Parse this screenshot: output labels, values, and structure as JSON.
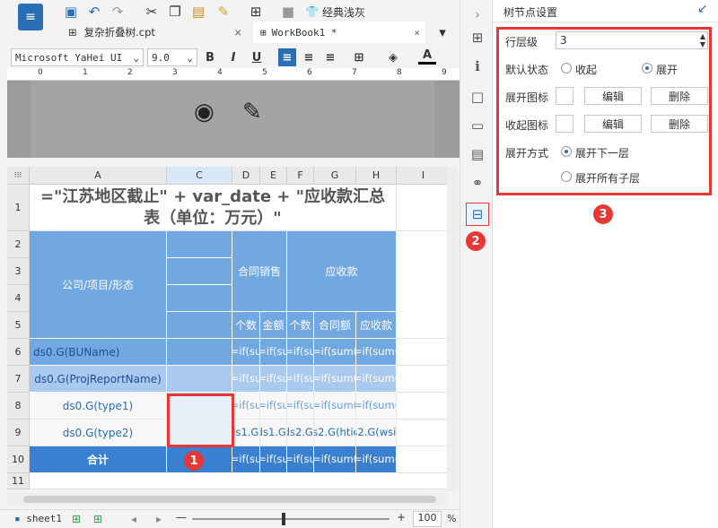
{
  "toolbar": {
    "theme_label": "经典浅灰"
  },
  "tabs": [
    {
      "label": "复杂折叠树.cpt"
    },
    {
      "label": "WorkBook1 *"
    }
  ],
  "format": {
    "font_name": "Microsoft YaHei UI",
    "font_size": "9.0",
    "bold": "B",
    "italic": "I",
    "underline": "U",
    "font_color": "A"
  },
  "ruler": {
    "ticks": [
      "0",
      "1",
      "2",
      "3",
      "4",
      "5",
      "6",
      "7",
      "8",
      "9"
    ]
  },
  "columns": [
    "A",
    "C",
    "D",
    "E",
    "F",
    "G",
    "H",
    "I"
  ],
  "rows": [
    "1",
    "2",
    "3",
    "4",
    "5",
    "6",
    "7",
    "8",
    "9",
    "10",
    "11"
  ],
  "cells": {
    "title": "=\"江苏地区截止\" + var_date + \"应收款汇总表（单位：万元）\"",
    "company": "公司/项目/形态",
    "contract_sales": "合同销售",
    "receivable": "应收款",
    "count": "个数",
    "amount": "金额",
    "count2": "个数",
    "contract_amount": "合同额",
    "receivable_amount": "应收款",
    "bu": "ds0.G(BUName)",
    "proj": "ds0.G(ProjReportName)",
    "type1": "ds0.G(type1)",
    "type2": "ds0.G(type2)",
    "total": "合计",
    "f_ifsu": "=if(su",
    "f_ifsum": "=if(sum(",
    "f_ds1g": "ds1.G(",
    "f_ds2g": "ds2.G(",
    "f_ds2htie": "ds2.G(htie)",
    "f_ds2wsie": "ds2.G(wsie)"
  },
  "status": {
    "sheet": "sheet1",
    "zoom": "100",
    "percent": "%"
  },
  "panel": {
    "title": "树节点设置",
    "level_label": "行层级",
    "level_value": "3",
    "default_state_label": "默认状态",
    "collapse": "收起",
    "expand": "展开",
    "expand_icon_label": "展开图标",
    "collapse_icon_label": "收起图标",
    "edit": "编辑",
    "delete": "删除",
    "expand_mode_label": "展开方式",
    "expand_next": "展开下一层",
    "expand_all": "展开所有子层"
  },
  "badges": {
    "b1": "1",
    "b2": "2",
    "b3": "3"
  },
  "colors": {
    "accent": "#2a6fb5",
    "annotation": "#e53935",
    "cell_blue": "#72a8e2",
    "cell_light": "#a9c9ee",
    "cell_dark": "#3a7fd0"
  }
}
